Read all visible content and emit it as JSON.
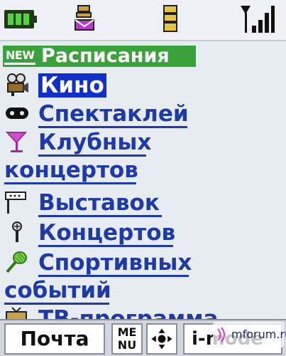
{
  "menu": {
    "header": {
      "badge": "NEW",
      "title": "Расписания"
    },
    "items": [
      {
        "id": "kino",
        "label": "Кино",
        "selected": true,
        "icon": "film-camera-icon"
      },
      {
        "id": "spektakley",
        "label": "Спектаклей",
        "icon": "theater-mask-icon"
      },
      {
        "id": "klubnyh",
        "label": "Клубных",
        "continuation": "концертов",
        "icon": "cocktail-glass-icon"
      },
      {
        "id": "vystavok",
        "label": "Выставок",
        "icon": "exhibition-easel-icon"
      },
      {
        "id": "kontsertov",
        "label": "Концертов",
        "icon": "microphone-icon"
      },
      {
        "id": "sportivnyh",
        "label": "Спортивных",
        "continuation": "событий",
        "icon": "tennis-racket-icon"
      },
      {
        "id": "tv",
        "label": "ТВ-программа",
        "icon": "tv-icon"
      }
    ]
  },
  "softkeys": {
    "left": "Почта",
    "menu": "МЕ\nNU",
    "right": "i-mode"
  },
  "watermark": "mforum.ru",
  "colors": {
    "header_bg": "#3aa23a",
    "item_text": "#1e3aa8",
    "selected_bg": "#112fc9",
    "screen_bg": "#e7ebf2"
  }
}
